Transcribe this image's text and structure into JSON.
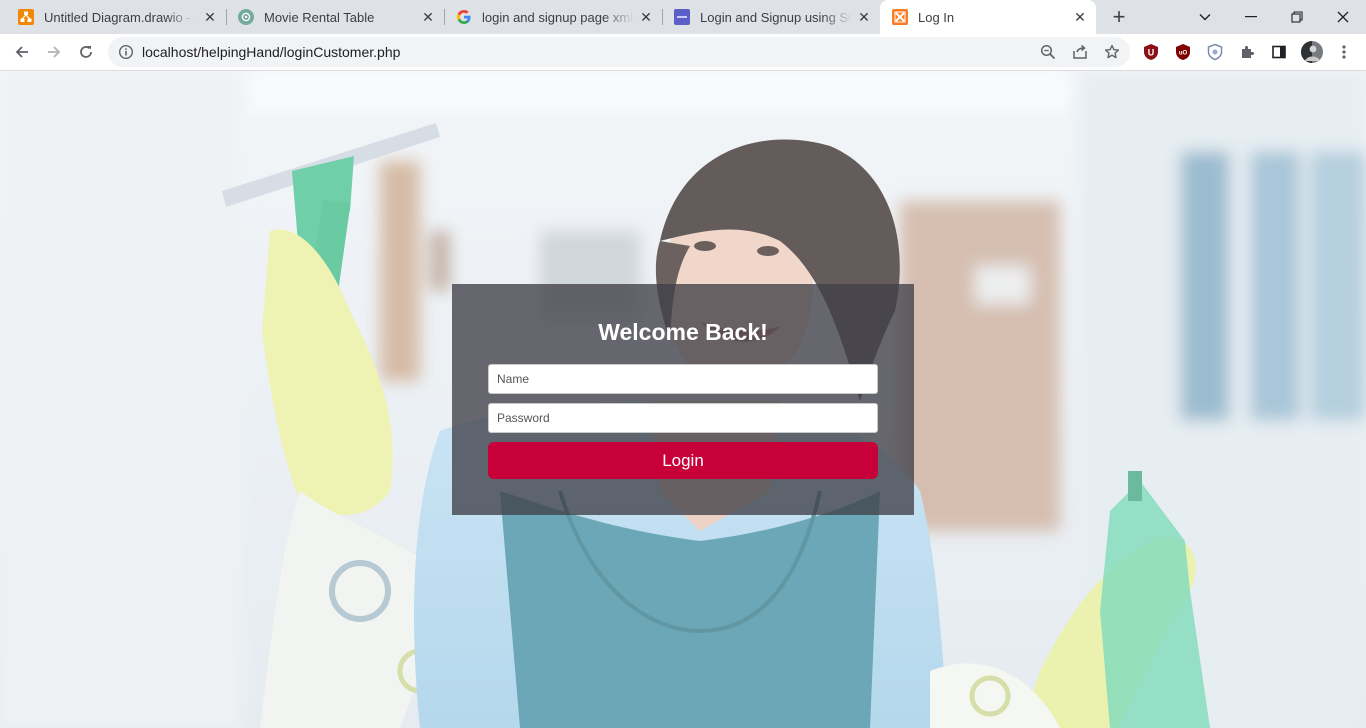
{
  "browser": {
    "tabs": [
      {
        "title": "Untitled Diagram.drawio - draw.io",
        "favicon": "drawio-icon"
      },
      {
        "title": "Movie Rental Table",
        "favicon": "chatgpt-icon"
      },
      {
        "title": "login and signup page xml and",
        "favicon": "google-icon"
      },
      {
        "title": "Login and Signup using SQLite",
        "favicon": "site-icon"
      },
      {
        "title": "Log In",
        "favicon": "xampp-icon"
      }
    ],
    "active_tab": 4,
    "address": "localhost/helpingHand/loginCustomer.php",
    "colors": {
      "tabstrip": "#dee1e6",
      "omnibox": "#f1f3f4"
    }
  },
  "page": {
    "heading": "Welcome Back!",
    "name_placeholder": "Name",
    "password_placeholder": "Password",
    "login_label": "Login",
    "colors": {
      "accent": "#c8003a",
      "card": "#404048"
    }
  }
}
